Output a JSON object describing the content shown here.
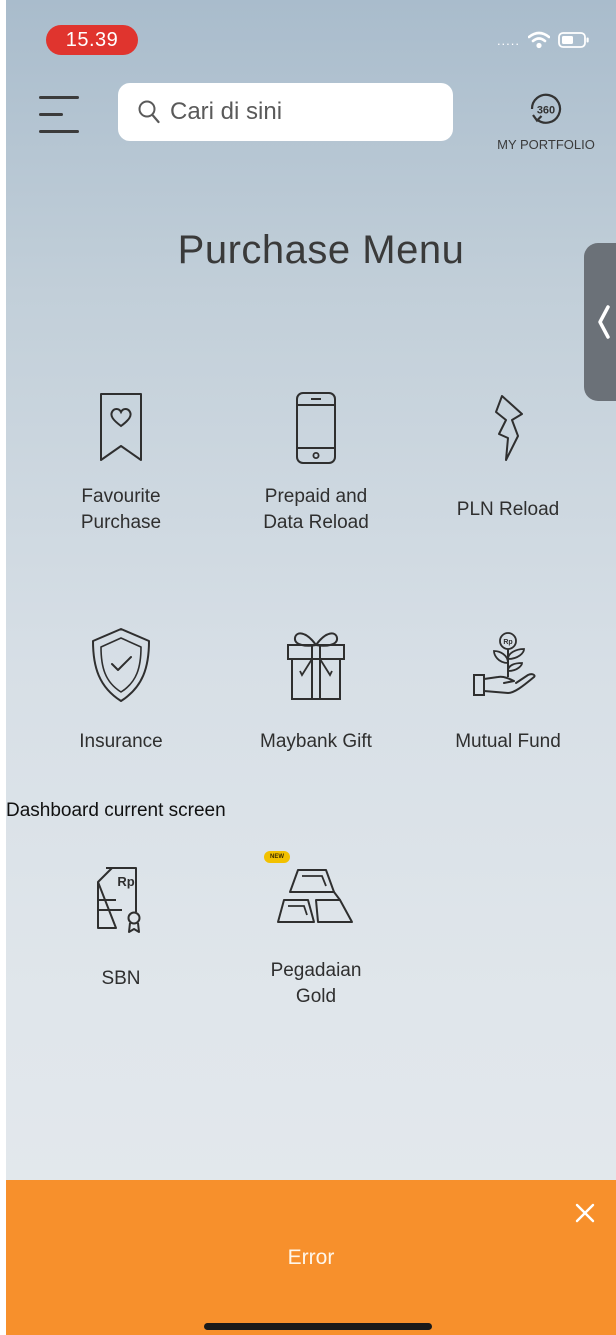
{
  "status_bar": {
    "time": "15.39"
  },
  "header": {
    "search_placeholder": "Cari di sini",
    "portfolio_icon_text": "360",
    "portfolio_label": "MY PORTFOLIO"
  },
  "page_title": "Purchase Menu",
  "menu_items": [
    {
      "label": "Favourite\nPurchase",
      "icon": "bookmark-heart-icon"
    },
    {
      "label": "Prepaid and\nData Reload",
      "icon": "phone-icon"
    },
    {
      "label": "PLN Reload",
      "icon": "lightning-icon"
    },
    {
      "label": "Insurance",
      "icon": "shield-check-icon"
    },
    {
      "label": "Maybank Gift",
      "icon": "gift-icon"
    },
    {
      "label": "Mutual Fund",
      "icon": "hand-plant-icon"
    },
    {
      "label": "SBN",
      "icon": "certificate-icon",
      "icon_text": "Rp"
    },
    {
      "label": "Pegadaian\nGold",
      "icon": "gold-bars-icon",
      "badge": "NEW"
    }
  ],
  "overlay_caption": "Dashboard current screen",
  "error_bar": {
    "message": "Error"
  },
  "colors": {
    "time_pill": "#e0342e",
    "error_bar": "#f7902c",
    "side_tab": "#6b7178",
    "badge": "#f2c100"
  }
}
